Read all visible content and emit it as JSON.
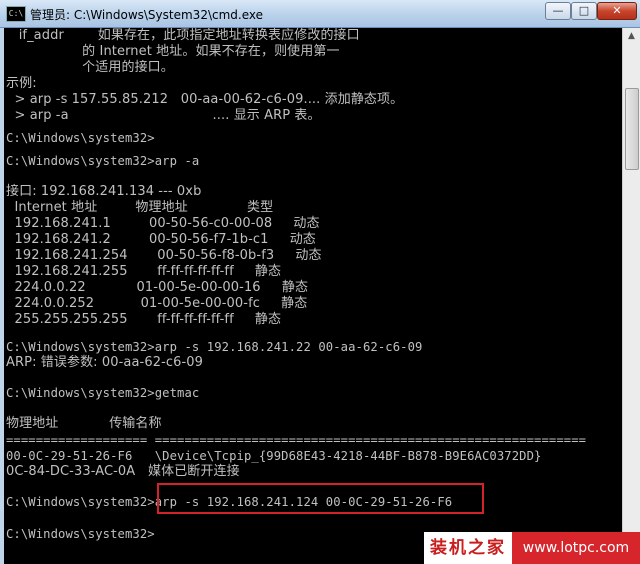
{
  "window": {
    "icon_label": "C:\\",
    "title": "管理员: C:\\Windows\\System32\\cmd.exe",
    "minimize_glyph": "—",
    "maximize_glyph": "□",
    "close_glyph": "✕"
  },
  "console": {
    "lines": [
      "   if_addr        如果存在，此项指定地址转换表应修改的接口",
      "                  的 Internet 地址。如果不存在，则使用第一",
      "                  个适用的接口。",
      "示例:",
      "  > arp -s 157.55.85.212   00-aa-00-62-c6-09.... 添加静态项。",
      "  > arp -a                                  .... 显示 ARP 表。",
      "",
      "C:\\Windows\\system32>",
      "C:\\Windows\\system32>arp -a",
      "",
      "接口: 192.168.241.134 --- 0xb",
      "  Internet 地址         物理地址              类型",
      "  192.168.241.1         00-50-56-c0-00-08     动态",
      "  192.168.241.2         00-50-56-f7-1b-c1     动态",
      "  192.168.241.254       00-50-56-f8-0b-f3     动态",
      "  192.168.241.255       ff-ff-ff-ff-ff-ff     静态",
      "  224.0.0.22            01-00-5e-00-00-16     静态",
      "  224.0.0.252           01-00-5e-00-00-fc     静态",
      "  255.255.255.255       ff-ff-ff-ff-ff-ff     静态",
      "",
      "C:\\Windows\\system32>arp -s 192.168.241.22 00-aa-62-c6-09",
      "ARP: 错误参数: 00-aa-62-c6-09",
      "",
      "C:\\Windows\\system32>getmac",
      "",
      "物理地址            传输名称",
      "=================== ==========================================================",
      "00-0C-29-51-26-F6   \\Device\\Tcpip_{99D68E43-4218-44BF-B878-B9E6AC0372DD}",
      "0C-84-DC-33-AC-0A   媒体已断开连接",
      "",
      "C:\\Windows\\system32>arp -s 192.168.241.124 00-0C-29-51-26-F6",
      "",
      "C:\\Windows\\system32>"
    ]
  },
  "scrollbar": {
    "up_glyph": "▲"
  },
  "watermark": {
    "brand": "装机之家",
    "url": "www.lotpc.com"
  }
}
